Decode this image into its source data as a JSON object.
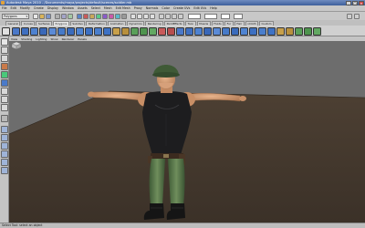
{
  "window": {
    "title": "Autodesk Maya 2010 - /Documents/maya/projects/default/scenes/soldier.mb"
  },
  "menubar": {
    "items": [
      "File",
      "Edit",
      "Modify",
      "Create",
      "Display",
      "Window",
      "Assets",
      "Select",
      "Mesh",
      "Edit Mesh",
      "Proxy",
      "Normals",
      "Color",
      "Create UVs",
      "Edit UVs",
      "Help"
    ]
  },
  "statusline": {
    "mode": "Polygons"
  },
  "shelf": {
    "tabs": [
      "General",
      "Curves",
      "Surfaces",
      "Polygons",
      "Subdivs",
      "Deformation",
      "Animation",
      "Dynamics",
      "Rendering",
      "PaintEffects",
      "Toon",
      "Muscle",
      "Fluids",
      "Fur",
      "Hair",
      "nCloth",
      "Custom"
    ],
    "active_tab": "Polygons"
  },
  "panel_menu": {
    "items": [
      "View",
      "Shading",
      "Lighting",
      "Show",
      "Renderer",
      "Panels"
    ]
  },
  "helpline": {
    "text": "Select Tool: select an object"
  },
  "colors": {
    "viewport_bg": "#6d6d6d",
    "floor": "#4a3e32",
    "ui_gray": "#c8c8c8",
    "title_blue": "#4a6aa8"
  }
}
